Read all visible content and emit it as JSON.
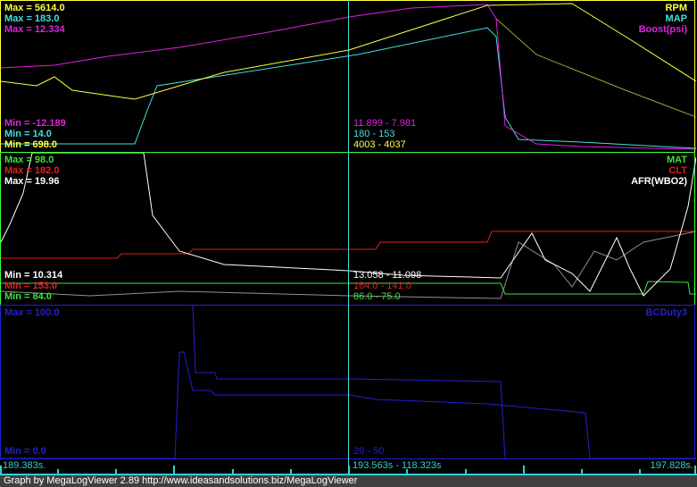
{
  "panels": [
    {
      "series": [
        {
          "name": "RPM",
          "color": "#ffff40",
          "max": "Max = 5614.0",
          "min": "Min = 698.0",
          "cursor": "4003 - 4037"
        },
        {
          "name": "MAP",
          "color": "#40e0e0",
          "max": "Max = 183.0",
          "min": "Min = 14.0",
          "cursor": "180 - 153"
        },
        {
          "name": "Boost(psi)",
          "color": "#e020e0",
          "max": "Max = 12.334",
          "min": "Min = -12.189",
          "cursor": "11.899 - 7.981"
        }
      ]
    },
    {
      "series": [
        {
          "name": "MAT",
          "color": "#40e040",
          "max": "Max = 98.0",
          "min": "Min = 84.0",
          "cursor": "86.0 - 75.0"
        },
        {
          "name": "CLT",
          "color": "#e02020",
          "max": "Max = 182.0",
          "min": "Min = 153.0",
          "cursor": "164.0 - 141.0"
        },
        {
          "name": "AFR(WBO2)",
          "color": "#ffffff",
          "max": "Max = 19.96",
          "min": "Min = 10.314",
          "cursor": "13.058 - 11.098"
        }
      ]
    },
    {
      "series": [
        {
          "name": "BCDuty3",
          "color": "#2020d0",
          "max": "Max = 100.0",
          "min": "Min = 0.0",
          "cursor": "29 - 50"
        }
      ]
    }
  ],
  "time_axis": {
    "start": "189.383s.",
    "cursor": "193.563s - 118.323s",
    "end": "197.828s."
  },
  "footer": "Graph by MegaLogViewer 2.89 http://www.ideasandsolutions.biz/MegaLogViewer"
}
